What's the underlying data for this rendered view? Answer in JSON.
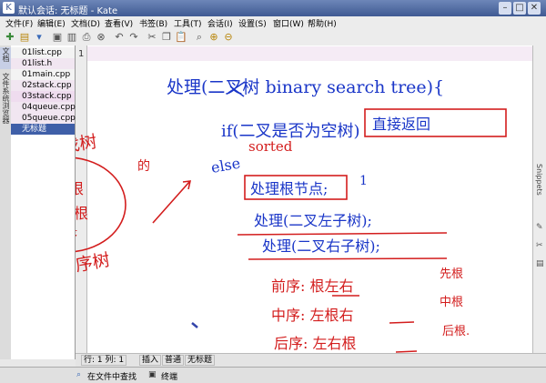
{
  "window": {
    "title": "默认会话: 无标题 - Kate"
  },
  "menu": [
    "文件(F)",
    "编辑(E)",
    "文档(D)",
    "查看(V)",
    "书签(B)",
    "工具(T)",
    "会话(I)",
    "设置(S)",
    "窗口(W)",
    "帮助(H)"
  ],
  "side_tabs": {
    "documents": "文档",
    "filesystem": "文件系统浏览器"
  },
  "files": [
    "01list.cpp",
    "01list.h",
    "01main.cpp",
    "02stack.cpp",
    "03stack.cpp",
    "04queue.cpp",
    "05queue.cpp",
    "无标题"
  ],
  "editor": {
    "line_number": "1"
  },
  "right_tab": "Snippets",
  "handwriting": {
    "left1": "二叉查找树",
    "left_circle1": "左小于根",
    "left_circle2": "右大于根",
    "left_note": "有序",
    "left_de": "的",
    "left3": "二叉排序树",
    "top": "处理(二叉树 binary search tree){",
    "if_line": "if(二叉是否为空树)",
    "direct_return": "直接返回",
    "sorted": "sorted",
    "else": "else",
    "node": "处理根节点;",
    "one": "1",
    "left_sub": "处理(二叉左子树);",
    "right_sub": "处理(二叉右子树);",
    "pre": "前序: 根左右",
    "pre_note": "先根",
    "in": "中序: 左根右",
    "in_note": "中根",
    "post": "后序: 左右根",
    "post_note": "后根."
  },
  "status": {
    "position": "行: 1 列: 1",
    "mode": "插入",
    "encoding": "普通",
    "doc": "无标题"
  },
  "bottom_bar": {
    "find": "在文件中查找",
    "terminal": "终端"
  },
  "colors": {
    "ink_blue": "#1a36c8",
    "ink_red": "#d31d1d",
    "title_bar": "#3f5a93"
  }
}
